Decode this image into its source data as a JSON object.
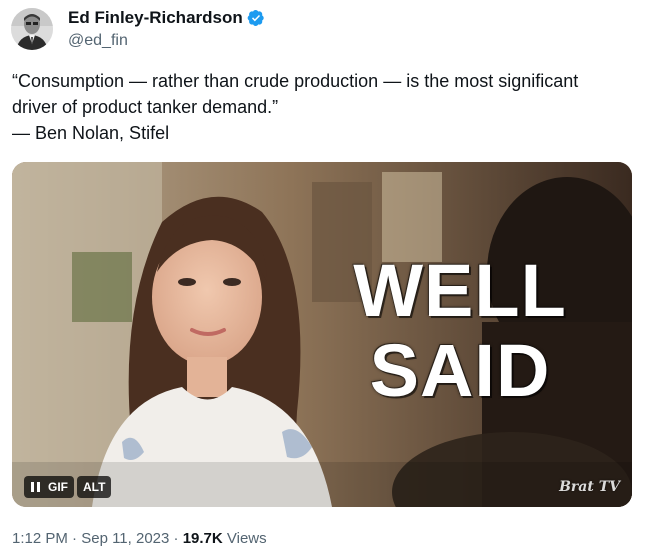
{
  "author": {
    "display_name": "Ed Finley-Richardson",
    "handle": "@ed_fin",
    "verified": true,
    "verified_icon": "verified-badge-icon",
    "verified_color": "#1d9bf0"
  },
  "tweet": {
    "lines": [
      "“Consumption — rather than crude production — is the most significant",
      "driver of product tanker demand.”",
      "— Ben Nolan, Stifel"
    ]
  },
  "media": {
    "overlay_line1": "WELL",
    "overlay_line2": "SAID",
    "pause_icon": "pause-icon",
    "gif_label": "GIF",
    "alt_label": "ALT",
    "watermark": "Brat TV"
  },
  "meta": {
    "time": "1:12 PM",
    "separator1": " · ",
    "date": "Sep 11, 2023",
    "separator2": " · ",
    "views_count": "19.7K",
    "views_label": " Views"
  },
  "colors": {
    "text_primary": "#0f1419",
    "text_secondary": "#536471",
    "accent": "#1d9bf0"
  }
}
